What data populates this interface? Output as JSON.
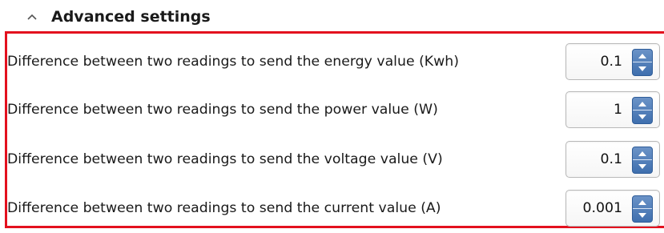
{
  "section": {
    "title": "Advanced settings",
    "collapse_icon": "chevron-up-icon"
  },
  "settings": [
    {
      "label": "Difference between two readings to send the energy value (Kwh)",
      "value": "0.1"
    },
    {
      "label": "Difference between two readings to send the power value (W)",
      "value": "1"
    },
    {
      "label": "Difference between two readings to send the voltage value (V)",
      "value": "0.1"
    },
    {
      "label": "Difference between two readings to send the current value (A)",
      "value": "0.001"
    }
  ],
  "colors": {
    "highlight_border": "#e3101e",
    "spinner_button": "#4a78b5"
  },
  "icons": {
    "increment": "arrow-up-icon",
    "decrement": "arrow-down-icon"
  }
}
